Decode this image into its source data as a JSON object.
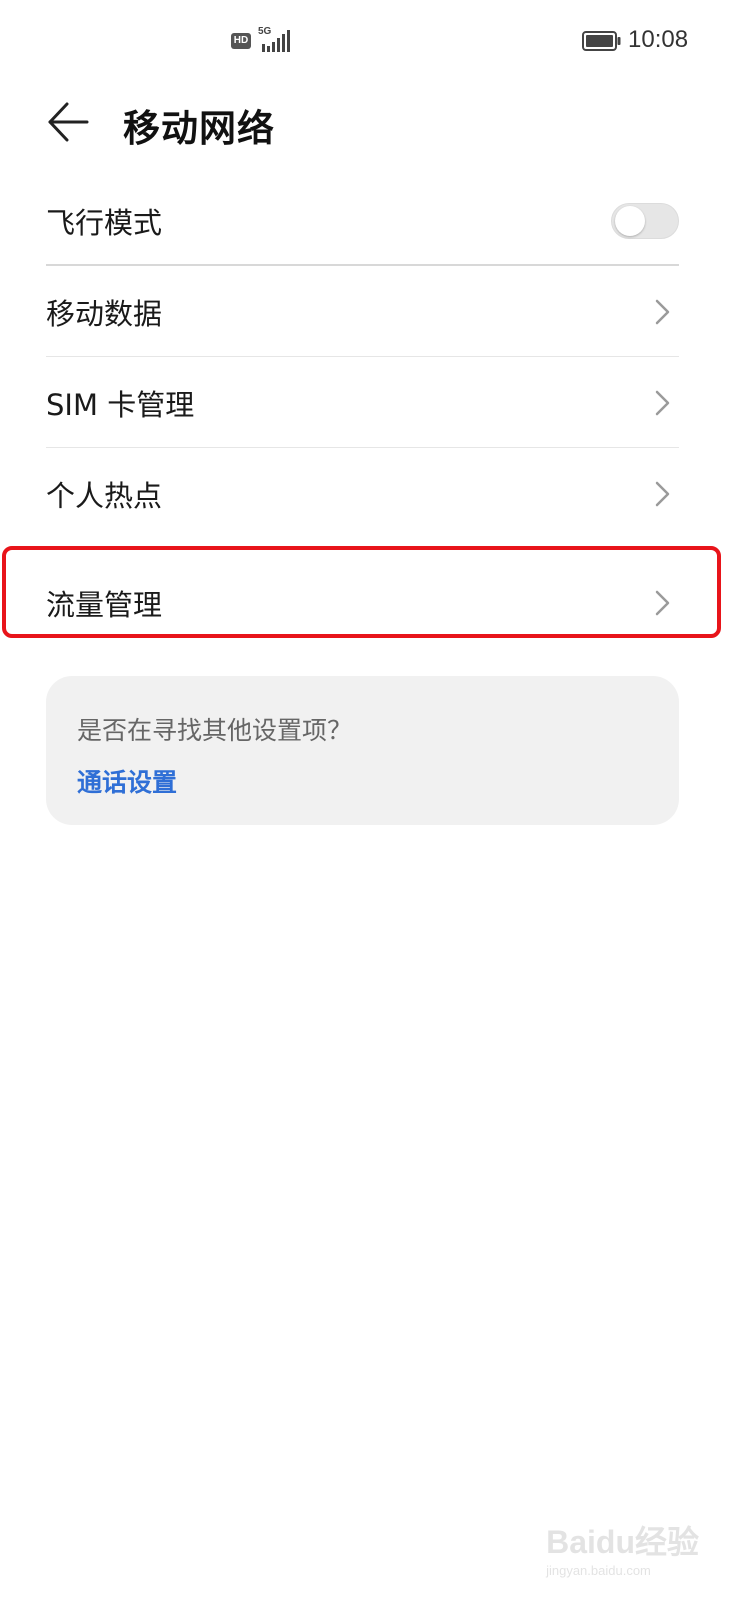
{
  "status_bar": {
    "hd_label": "HD",
    "network_type": "5G",
    "time": "10:08",
    "icons": [
      "hd-voice-icon",
      "signal-icon",
      "battery-icon"
    ]
  },
  "header": {
    "back_icon": "back-arrow-icon",
    "title": "移动网络"
  },
  "list": {
    "airplane_mode": {
      "label": "飞行模式",
      "toggle_on": false
    },
    "items": [
      {
        "label": "移动数据",
        "icon": "chevron-right-icon"
      },
      {
        "label": "SIM 卡管理",
        "icon": "chevron-right-icon"
      },
      {
        "label": "个人热点",
        "icon": "chevron-right-icon"
      },
      {
        "label": "流量管理",
        "icon": "chevron-right-icon",
        "highlighted": true
      }
    ]
  },
  "suggestion": {
    "question": "是否在寻找其他设置项？",
    "link": "通话设置"
  },
  "watermark": {
    "text": "Baidu经验",
    "sub": "jingyan.baidu.com"
  },
  "colors": {
    "highlight_border": "#e8141a",
    "link": "#2f6fd6",
    "card_bg": "#f1f1f1",
    "toggle_off": "#e6e6e6"
  }
}
